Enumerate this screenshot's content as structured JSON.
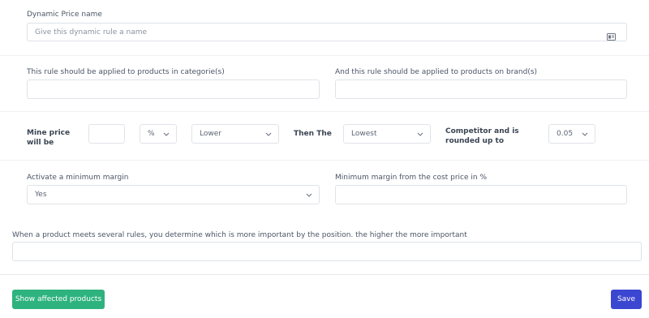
{
  "name_section": {
    "label": "Dynamic Price name",
    "placeholder": "Give this dynamic rule a name"
  },
  "scope_section": {
    "categories_label": "This rule should be applied to products in categorie(s)",
    "brands_label": "And this rule should be applied to products on brand(s)"
  },
  "pricing_rule": {
    "mine_price_label": "Mine price will be",
    "amount_value": "",
    "unit_selected": "%",
    "direction_selected": "Lower",
    "then_label": "Then The",
    "competitor_selected": "Lowest",
    "competitor_label": "Competitor and is rounded up to",
    "rounding_selected": "0.05"
  },
  "margin_section": {
    "activate_label": "Activate a minimum margin",
    "activate_selected": "Yes",
    "min_margin_label": "Minimum margin from the cost price in %"
  },
  "priority_section": {
    "label": "When a product meets several rules, you determine which is more important by the position. the higher the more important"
  },
  "footer": {
    "show_affected_label": "Show affected products",
    "save_label": "Save"
  },
  "colors": {
    "primary": "#3b46d1",
    "success": "#2eb37f",
    "border": "#dfe3e8"
  },
  "icons": [
    "id-card-icon",
    "chevron-down-icon"
  ]
}
